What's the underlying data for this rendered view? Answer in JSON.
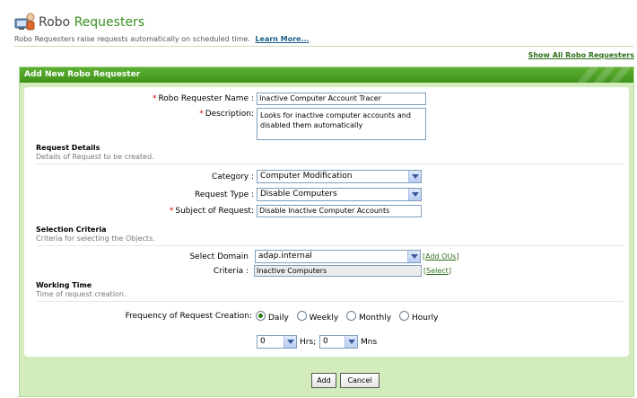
{
  "header": {
    "title_part1": "Robo ",
    "title_part2": "Requesters",
    "subtitle": "Robo Requesters raise requests automatically on scheduled time.",
    "learn_more": "Learn More...",
    "show_all": "Show All Robo Requesters",
    "logo_icon": "robot-computer-icon"
  },
  "panel": {
    "title": "Add New Robo Requester"
  },
  "form": {
    "name_label": "Robo Requester Name :",
    "name_value": "Inactive Computer Account Tracer",
    "desc_label": "Description:",
    "desc_value": "Looks for inactive computer accounts and disabled them automatically",
    "request_details_title": "Request Details",
    "request_details_desc": "Details of Request to be created.",
    "category_label": "Category :",
    "category_value": "Computer Modification",
    "request_type_label": "Request Type :",
    "request_type_value": "Disable Computers",
    "subject_label": "Subject of Request:",
    "subject_value": "Disable Inactive Computer Accounts",
    "selection_title": "Selection Criteria",
    "selection_desc": "Criteria for selecting the Objects.",
    "domain_label": "Select Domain",
    "domain_value": "adap.internal",
    "add_ous": "Add OUs",
    "criteria_label": "Criteria :",
    "criteria_value": "Inactive Computers",
    "select_link": "Select",
    "working_title": "Working Time",
    "working_desc": "Time of request creation.",
    "frequency_label": "Frequency of Request Creation:",
    "frequency_options": [
      "Daily",
      "Weekly",
      "Monthly",
      "Hourly"
    ],
    "frequency_selected": "Daily",
    "hrs_value": "0",
    "hrs_label": "Hrs;",
    "mins_value": "0",
    "mins_label": "Mns"
  },
  "buttons": {
    "add": "Add",
    "cancel": "Cancel"
  },
  "colors": {
    "accent_green": "#3f931a",
    "panel_bg": "#d2ecbb",
    "required_red": "#cc0000"
  }
}
